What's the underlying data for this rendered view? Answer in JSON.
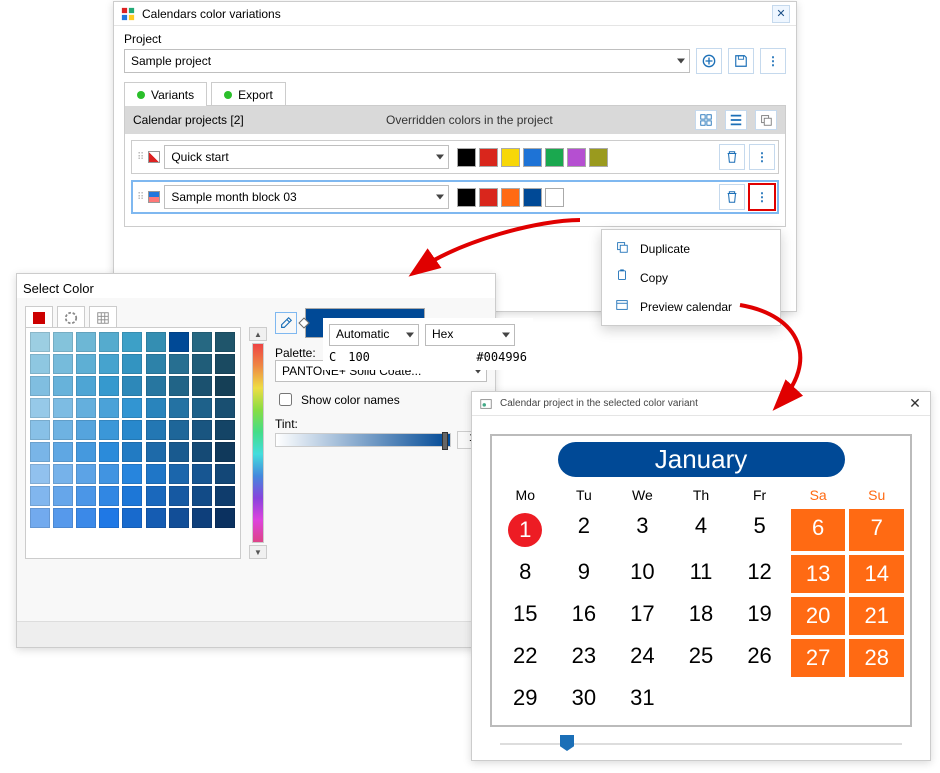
{
  "main_window": {
    "title": "Calendars color variations",
    "project_label": "Project",
    "project_value": "Sample project",
    "tabs": [
      {
        "label": "Variants"
      },
      {
        "label": "Export"
      }
    ],
    "panel": {
      "header_left": "Calendar projects  [2]",
      "header_right": "Overridden colors in the project"
    },
    "rows": [
      {
        "name": "Quick start",
        "swatches": [
          "#000000",
          "#d9261c",
          "#f7d708",
          "#1e73d6",
          "#1aa84f",
          "#b54fd1",
          "#9a9a1e"
        ]
      },
      {
        "name": "Sample month block 03",
        "swatches": [
          "#000000",
          "#d9261c",
          "#ff6a13",
          "#004996",
          "#ffffff"
        ]
      }
    ],
    "menu": {
      "items": [
        "Duplicate",
        "Copy",
        "Preview calendar"
      ]
    }
  },
  "color_window": {
    "title": "Select Color",
    "palette_label": "Palette:",
    "palette_value": "PANTONE+ Solid Coate...",
    "show_names_label": "Show color names",
    "tint_label": "Tint:",
    "tint_value": "1",
    "mode_left": "Automatic",
    "mode_right": "Hex",
    "channel_letter": "C",
    "channel_value": "100",
    "hex_value": "#004996",
    "grid_rows": 9,
    "grid_cols": 9,
    "selected_cell": 6
  },
  "preview_window": {
    "title": "Calendar project in the selected color variant",
    "month": "January",
    "weekdays": [
      "Mo",
      "Tu",
      "We",
      "Th",
      "Fr",
      "Sa",
      "Su"
    ],
    "days": [
      [
        1,
        2,
        3,
        4,
        5,
        6,
        7
      ],
      [
        8,
        9,
        10,
        11,
        12,
        13,
        14
      ],
      [
        15,
        16,
        17,
        18,
        19,
        20,
        21
      ],
      [
        22,
        23,
        24,
        25,
        26,
        27,
        28
      ],
      [
        29,
        30,
        31,
        null,
        null,
        null,
        null
      ]
    ],
    "today": 1,
    "weekend_cols": [
      5,
      6
    ]
  },
  "colors": {
    "accent": "#004996",
    "orange": "#ff6a13",
    "red": "#ed1c24",
    "link": "#1b6fb7"
  }
}
